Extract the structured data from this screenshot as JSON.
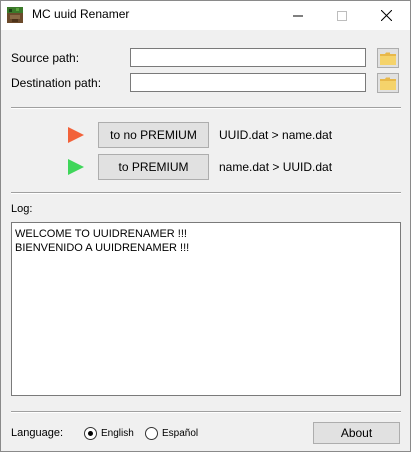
{
  "window": {
    "title": "MC uuid Renamer",
    "controls": {
      "minimize": "—",
      "maximize": "☐",
      "close": "✕"
    }
  },
  "paths": {
    "source_label": "Source path:",
    "source_value": "",
    "destination_label": "Destination path:",
    "destination_value": ""
  },
  "actions": [
    {
      "button_label": "to no PREMIUM",
      "description": "UUID.dat  >  name.dat",
      "arrow_color": "#f2623a"
    },
    {
      "button_label": "to PREMIUM",
      "description": "name.dat  >  UUID.dat",
      "arrow_color": "#3fd65a"
    }
  ],
  "log": {
    "label": "Log:",
    "lines": [
      "WELCOME TO UUIDRENAMER !!!",
      "BIENVENIDO A UUIDRENAMER !!!"
    ]
  },
  "footer": {
    "language_label": "Language:",
    "languages": [
      {
        "label": "English",
        "selected": true
      },
      {
        "label": "Español",
        "selected": false
      }
    ],
    "about_label": "About"
  },
  "icons": {
    "app": "pixel-creeper-icon",
    "folder": "folder-icon",
    "folder_color": "#f5d36b"
  }
}
